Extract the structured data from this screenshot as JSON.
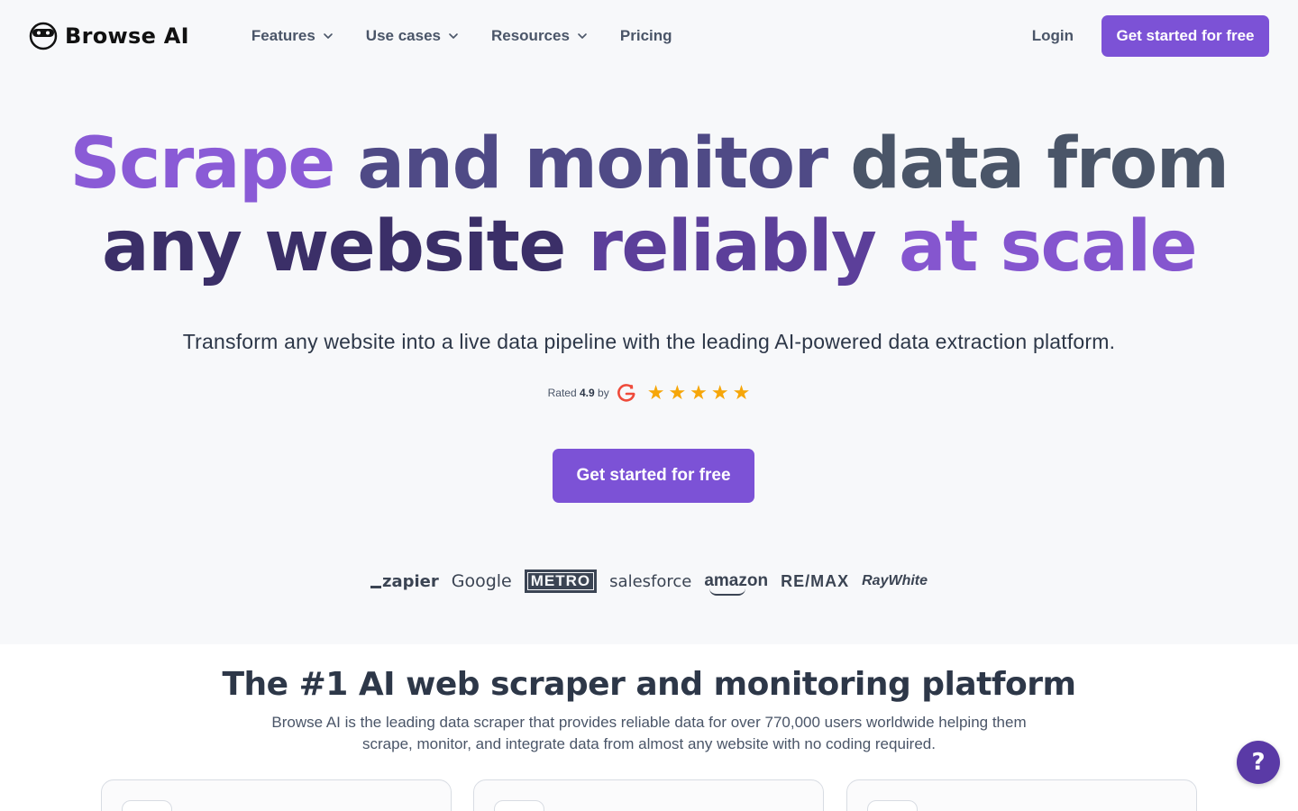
{
  "nav": {
    "logo_text": "Browse AI",
    "links": [
      {
        "label": "Features",
        "has_dropdown": true
      },
      {
        "label": "Use cases",
        "has_dropdown": true
      },
      {
        "label": "Resources",
        "has_dropdown": true
      },
      {
        "label": "Pricing",
        "has_dropdown": false
      }
    ],
    "login_label": "Login",
    "cta_label": "Get started for free"
  },
  "hero": {
    "title_line1": [
      "Scrape",
      "and",
      "monitor",
      "data from"
    ],
    "title_line2": [
      "any",
      "website",
      "reliably",
      "at scale"
    ],
    "subtitle": "Transform any website into a live data pipeline with the leading AI-powered data extraction platform.",
    "rating_prefix": "Rated",
    "rating_value": "4.9",
    "rating_suffix": "by",
    "rating_source_icon": "g2-logo",
    "stars": 5,
    "cta_label": "Get started for free"
  },
  "brands": [
    "zapier",
    "Google",
    "METRO",
    "salesforce",
    "amazon",
    "RE/MAX",
    "RayWhite"
  ],
  "section2": {
    "title": "The #1 AI web scraper and monitoring platform",
    "description": "Browse AI is the leading data scraper that provides reliable data for over 770,000 users worldwide helping them scrape, monitor, and integrate data from almost any website with no coding required."
  },
  "help": {
    "label": "?",
    "icon": "help-icon"
  },
  "colors": {
    "accent": "#7c52d6",
    "help_bg": "#5a3aa6",
    "star": "#f6a609",
    "heading": "#2d3748"
  }
}
